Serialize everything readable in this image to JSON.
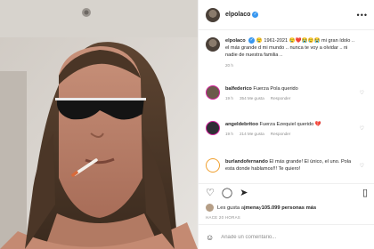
{
  "post": {
    "username": "elpolaco",
    "more_icon": "•••",
    "caption": {
      "username": "elpolaco",
      "text": "😢 1961-2021 😢❤️😭😢😭 mi gran ídolo .. el más grande d mi mundo .. nunca te voy a olvidar .. ni nadie de nuestra familia ..",
      "age": "20 h"
    },
    "comments": [
      {
        "username": "balfederico",
        "text": "Fuerza Pola querido",
        "age": "19 h",
        "likes": "354 Me gusta",
        "reply": "Responder",
        "ring": "#d6249f",
        "fill": "#6b5a4b"
      },
      {
        "username": "angeldebritoo",
        "text": "Fuerza Ezequiel querido 💔",
        "age": "19 h",
        "likes": "214 Me gusta",
        "reply": "Responder",
        "ring": "#d6249f",
        "fill": "#2f2f35"
      },
      {
        "username": "burlandofernando",
        "text": "El más grande! El único, el uno. Pola esta donde hablamos!!! Te quiero!",
        "age": "",
        "likes": "",
        "reply": "",
        "ring": "#f0a030",
        "fill": "#ffffff"
      }
    ],
    "likes": {
      "prefix": "Les gusta a ",
      "user": "jmena",
      "middle": " y ",
      "count": "105.099 personas más"
    },
    "timestamp": "HACE 20 HORAS",
    "add_comment": {
      "placeholder": "Añade un comentario..."
    },
    "icons": {
      "like": "heart-icon",
      "comment": "comment-icon",
      "share": "share-icon",
      "save": "bookmark-icon",
      "emoji": "emoji-icon"
    },
    "colors": {
      "verified": "#3897f0",
      "text": "#262626",
      "muted": "#8e8e8e"
    }
  }
}
